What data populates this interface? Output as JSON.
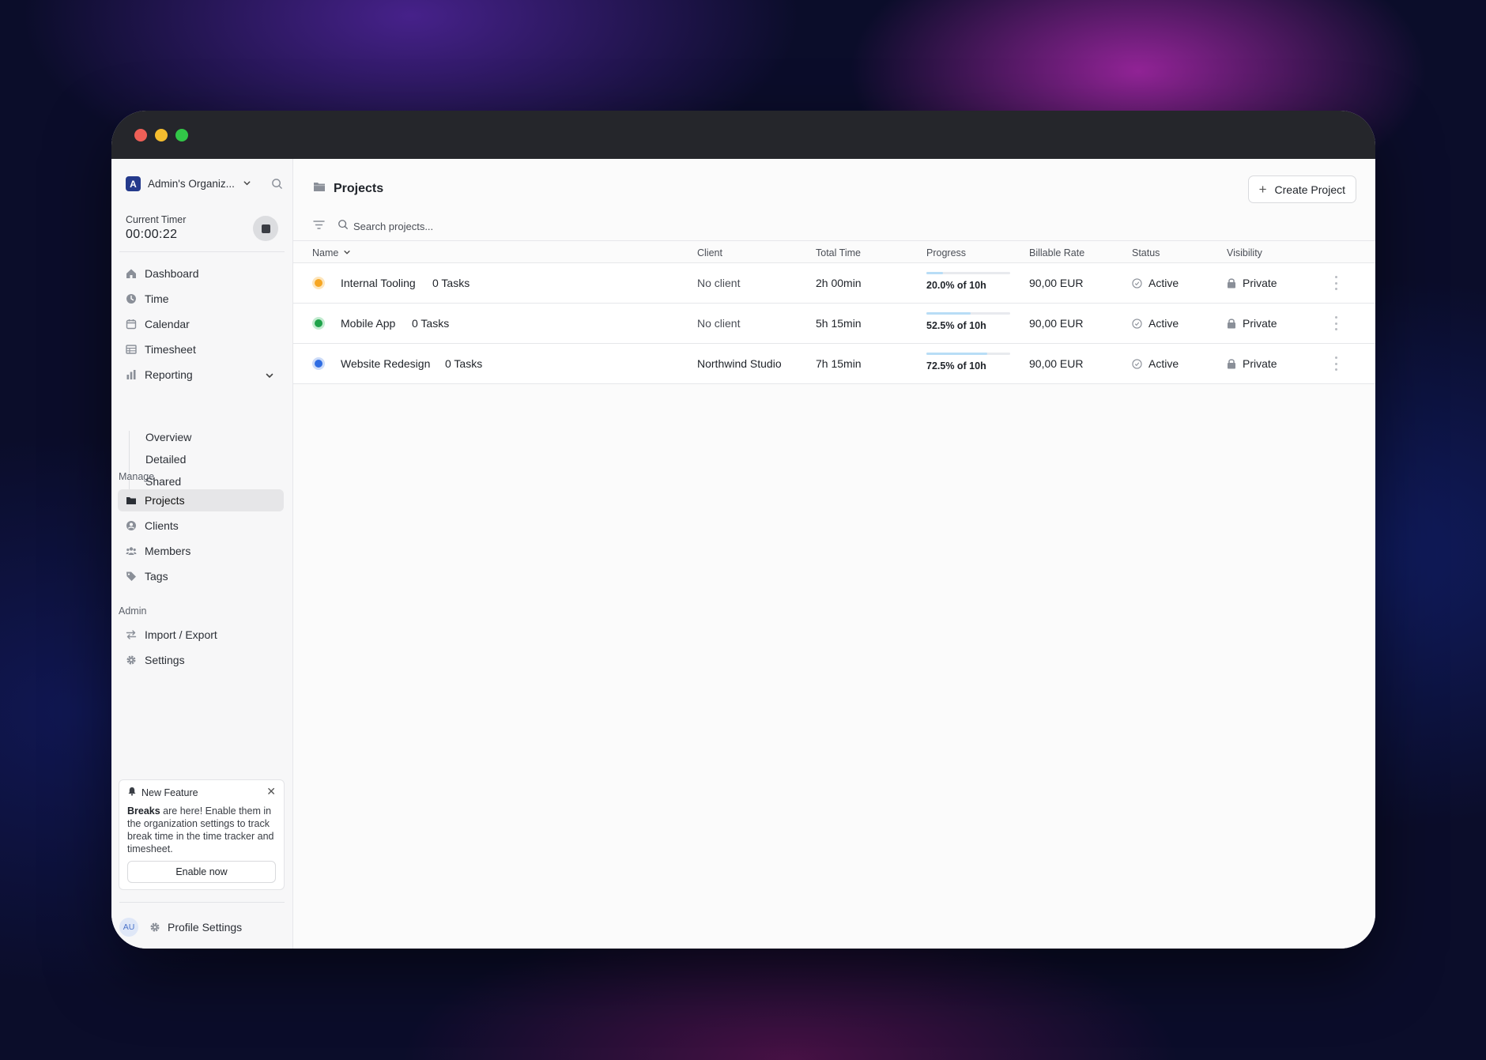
{
  "sidebar": {
    "org_initial": "A",
    "org_name": "Admin's Organiz...",
    "timer_label": "Current Timer",
    "timer_value": "00:00:22",
    "nav": {
      "dashboard": "Dashboard",
      "time": "Time",
      "calendar": "Calendar",
      "timesheet": "Timesheet",
      "reporting": "Reporting",
      "overview": "Overview",
      "detailed": "Detailed",
      "shared": "Shared"
    },
    "manage_label": "Manage",
    "manage": {
      "projects": "Projects",
      "clients": "Clients",
      "members": "Members",
      "tags": "Tags"
    },
    "admin_label": "Admin",
    "admin": {
      "import_export": "Import / Export",
      "settings": "Settings"
    },
    "feature": {
      "title": "New Feature",
      "bold": "Breaks",
      "text": " are here! Enable them in the organization settings to track break time in the time tracker and timesheet.",
      "button": "Enable now"
    },
    "profile": {
      "initials": "AU",
      "label": "Profile Settings"
    }
  },
  "main": {
    "title": "Projects",
    "create_button": "Create Project",
    "search_placeholder": "Search projects...",
    "columns": {
      "name": "Name",
      "client": "Client",
      "total_time": "Total Time",
      "progress": "Progress",
      "billable_rate": "Billable Rate",
      "status": "Status",
      "visibility": "Visibility"
    },
    "rows": [
      {
        "color": "#f6a623",
        "name": "Internal Tooling",
        "tasks": "0 Tasks",
        "client": "No client",
        "total_time": "2h 00min",
        "progress_fraction": 0.2,
        "progress_text": "20.0% of 10h",
        "billable_rate": "90,00 EUR",
        "status": "Active",
        "visibility": "Private"
      },
      {
        "color": "#1fa34a",
        "name": "Mobile App",
        "tasks": "0 Tasks",
        "client": "No client",
        "total_time": "5h 15min",
        "progress_fraction": 0.525,
        "progress_text": "52.5% of 10h",
        "billable_rate": "90,00 EUR",
        "status": "Active",
        "visibility": "Private"
      },
      {
        "color": "#2f6de3",
        "name": "Website Redesign",
        "tasks": "0 Tasks",
        "client": "Northwind Studio",
        "total_time": "7h 15min",
        "progress_fraction": 0.725,
        "progress_text": "72.5% of 10h",
        "billable_rate": "90,00 EUR",
        "status": "Active",
        "visibility": "Private"
      }
    ]
  }
}
